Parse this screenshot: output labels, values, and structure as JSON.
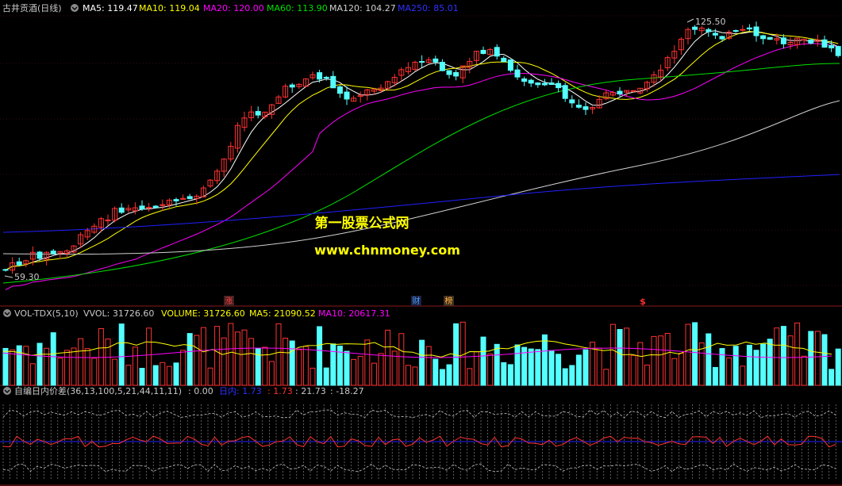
{
  "main_header": {
    "title": "古井贡酒(日线)",
    "ma5": "MA5: 119.47",
    "ma10": "MA10: 119.04",
    "ma20": "MA20: 120.00",
    "ma60": "MA60: 113.90",
    "ma120": "MA120: 104.27",
    "ma250": "MA250: 85.01"
  },
  "price_labels": {
    "high": "125.50",
    "low": "59.30"
  },
  "watermark": {
    "line1": "第一股票公式网",
    "line2": "www.chnmoney.com"
  },
  "event_markers": [
    {
      "text": "涨",
      "color": "#ff4040",
      "bg": "#402020"
    },
    {
      "text": "财",
      "color": "#40a0ff",
      "bg": "#202040"
    },
    {
      "text": "榜",
      "color": "#ffb040",
      "bg": "#403020"
    },
    {
      "text": "$",
      "color": "#ff3030",
      "bg": ""
    }
  ],
  "vol_header": {
    "name": "VOL-TDX(5,10)",
    "vvol": "VVOL: 31726.60",
    "volume": "VOLUME: 31726.60",
    "ma5": "MA5: 21090.52",
    "ma10": "MA10: 20617.31"
  },
  "ind_header": {
    "name": "自编日内价差(36,13,100,5,21,44,11,11)",
    "v0": ": 0.00",
    "v1": "日内: 1.73",
    "v2": ": 1.73",
    "v3": ": 21.73",
    "v4": ": -18.27"
  },
  "colors": {
    "up": "#ff3232",
    "down": "#54ffff",
    "ma5": "#ffffff",
    "ma10": "#ffff00",
    "ma20": "#ff00ff",
    "ma60": "#00e000",
    "ma120": "#d0d0d0",
    "ma250": "#2020ff",
    "frame": "#8b1a1a"
  }
}
